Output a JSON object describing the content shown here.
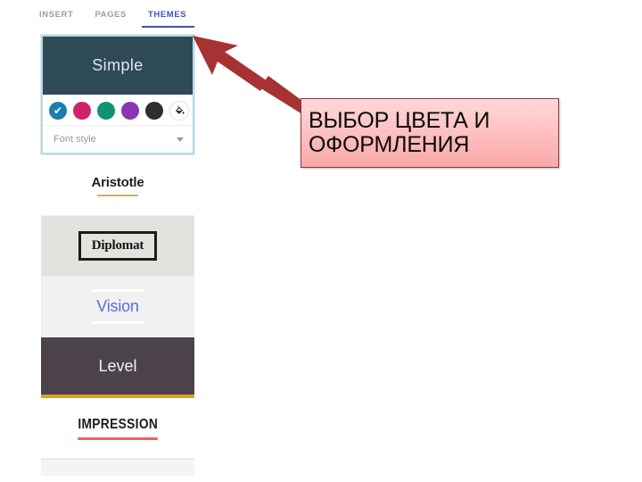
{
  "tabs": [
    {
      "label": "INSERT",
      "active": false
    },
    {
      "label": "PAGES",
      "active": false
    },
    {
      "label": "THEMES",
      "active": true
    }
  ],
  "themes_panel": {
    "selected_theme": "Simple",
    "simple_card": {
      "title": "Simple",
      "hero_color": "#2f4a57",
      "selection_border_color": "#b6dbe8",
      "swatches": [
        {
          "name": "blue",
          "color": "#1a7fae",
          "selected": true
        },
        {
          "name": "pink",
          "color": "#cf2369",
          "selected": false
        },
        {
          "name": "green",
          "color": "#129271",
          "selected": false
        },
        {
          "name": "purple",
          "color": "#8a36b5",
          "selected": false
        },
        {
          "name": "black",
          "color": "#2e2e2e",
          "selected": false
        }
      ],
      "selected_check_glyph": "✔",
      "custom_color_icon": "paint-bucket-icon",
      "font_style": {
        "label": "Font style",
        "value": "",
        "placeholder": "Font style"
      }
    },
    "themes": [
      {
        "name": "Aristotle",
        "background": "#ffffff",
        "text_color": "#1f1f1f",
        "accent_color": "#c8b271"
      },
      {
        "name": "Diplomat",
        "background": "#e2e2df",
        "text_color": "#141414",
        "accent_color": "#1b1b1b"
      },
      {
        "name": "Vision",
        "background": "#f1f1f1",
        "text_color": "#5a6ddb",
        "accent_color": "#ffffff"
      },
      {
        "name": "Level",
        "background": "#4b4349",
        "text_color": "#f2f2f2",
        "accent_color": "#d1a62b"
      },
      {
        "name": "IMPRESSION",
        "background": "#ffffff",
        "text_color": "#1c1c1c",
        "accent_color": "#e8645c"
      }
    ]
  },
  "annotation": {
    "arrow_color": "#a63232",
    "callout": {
      "line1": "ВЫБОР ЦВЕТА И",
      "line2": "ОФОРМЛЕНИЯ",
      "border_color": "#8a3b45",
      "fill_top": "#ffd8d8",
      "fill_bottom": "#f9a8a8",
      "text_color": "#0b0b0b"
    }
  }
}
